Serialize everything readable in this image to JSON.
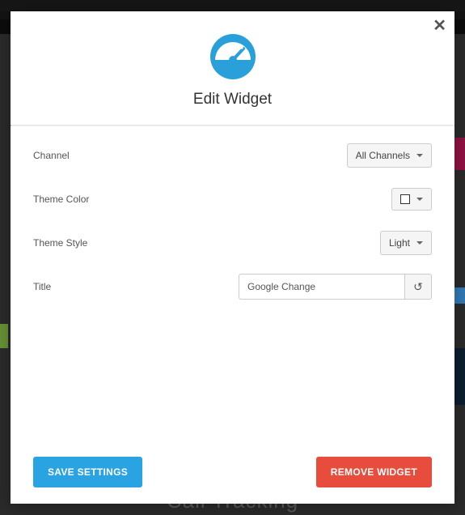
{
  "modal": {
    "title": "Edit Widget",
    "close_glyph": "✕"
  },
  "form": {
    "channel_label": "Channel",
    "channel_value": "All Channels",
    "theme_color_label": "Theme Color",
    "theme_color_value": "#ffffff",
    "theme_style_label": "Theme Style",
    "theme_style_value": "Light",
    "title_label": "Title",
    "title_value": "Google Change",
    "reset_glyph": "↺"
  },
  "footer": {
    "save_label": "SAVE SETTINGS",
    "remove_label": "REMOVE WIDGET"
  },
  "background": {
    "call_tracking": "Call Tracking"
  }
}
